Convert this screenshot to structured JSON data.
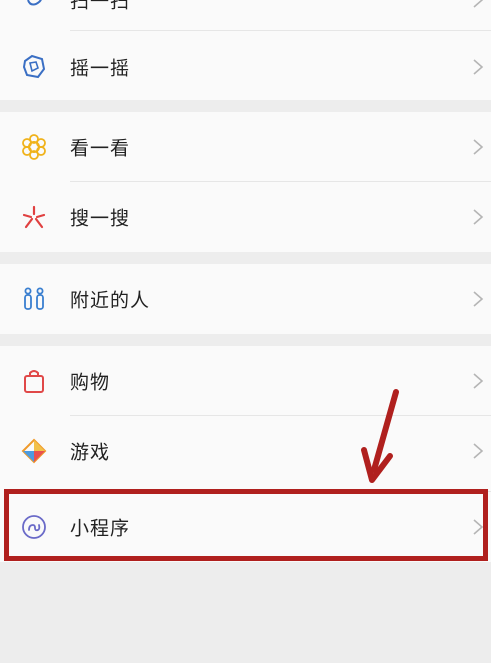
{
  "menu": {
    "items": [
      {
        "label": "扫一扫",
        "icon": "scan-icon"
      },
      {
        "label": "摇一摇",
        "icon": "shake-icon"
      },
      {
        "label": "看一看",
        "icon": "look-icon"
      },
      {
        "label": "搜一搜",
        "icon": "search-icon"
      },
      {
        "label": "附近的人",
        "icon": "people-nearby-icon"
      },
      {
        "label": "购物",
        "icon": "shopping-bag-icon"
      },
      {
        "label": "游戏",
        "icon": "game-icon"
      },
      {
        "label": "小程序",
        "icon": "mini-program-icon"
      }
    ]
  },
  "annotation": {
    "highlight_color": "#b0201e",
    "arrow_color": "#b0201e"
  }
}
